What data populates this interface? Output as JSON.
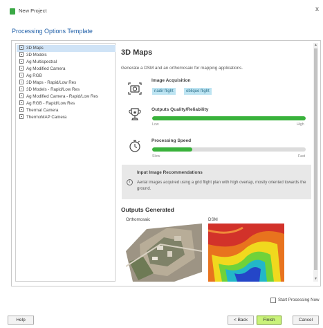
{
  "window": {
    "title": "New Project",
    "close_glyph": "x"
  },
  "page_title": "Processing Options Template",
  "templates": [
    {
      "label": "3D Maps",
      "selected": true
    },
    {
      "label": "3D Models"
    },
    {
      "label": "Ag Multispectral"
    },
    {
      "label": "Ag Modified Camera"
    },
    {
      "label": "Ag RGB"
    },
    {
      "label": "3D Maps - Rapid/Low Res"
    },
    {
      "label": "3D Models - Rapid/Low Res"
    },
    {
      "label": "Ag Modified Camera - Rapid/Low Res"
    },
    {
      "label": "Ag RGB - Rapid/Low Res"
    },
    {
      "label": "Thermal Camera"
    },
    {
      "label": "ThermoMAP Camera"
    }
  ],
  "details": {
    "title": "3D Maps",
    "description": "Generate a DSM and an orthomosaic for mapping applications.",
    "acquisition": {
      "label": "Image Acquisition",
      "chips": [
        "nadir flight",
        "oblique flight"
      ]
    },
    "quality": {
      "label": "Outputs Quality/Reliability",
      "low": "Low",
      "high": "High",
      "level": 1.0
    },
    "speed": {
      "label": "Processing Speed",
      "slow": "Slow",
      "fast": "Fast",
      "level": 0.26
    },
    "recommendations": {
      "title": "Input Image Recommendations",
      "text": "Aerial images acquired using a grid flight plan with high overlap, mostly oriented towards the ground."
    },
    "outputs": {
      "title": "Outputs Generated",
      "items": [
        {
          "label": "Orthomosaic"
        },
        {
          "label": "DSM"
        }
      ]
    }
  },
  "footer": {
    "start_processing": "Start Processing Now",
    "start_checked": false,
    "help": "Help",
    "back": "< Back",
    "finish": "Finish",
    "cancel": "Cancel"
  },
  "colors": {
    "accent_title": "#1f5fa8",
    "progress": "#39b23b",
    "chip_bg": "#bde4f2",
    "finish_bg": "#c9f27a"
  },
  "icons": [
    "app-icon",
    "template-icon",
    "camera-icon",
    "trophy-icon",
    "stopwatch-icon",
    "info-icon",
    "checkbox-icon"
  ]
}
